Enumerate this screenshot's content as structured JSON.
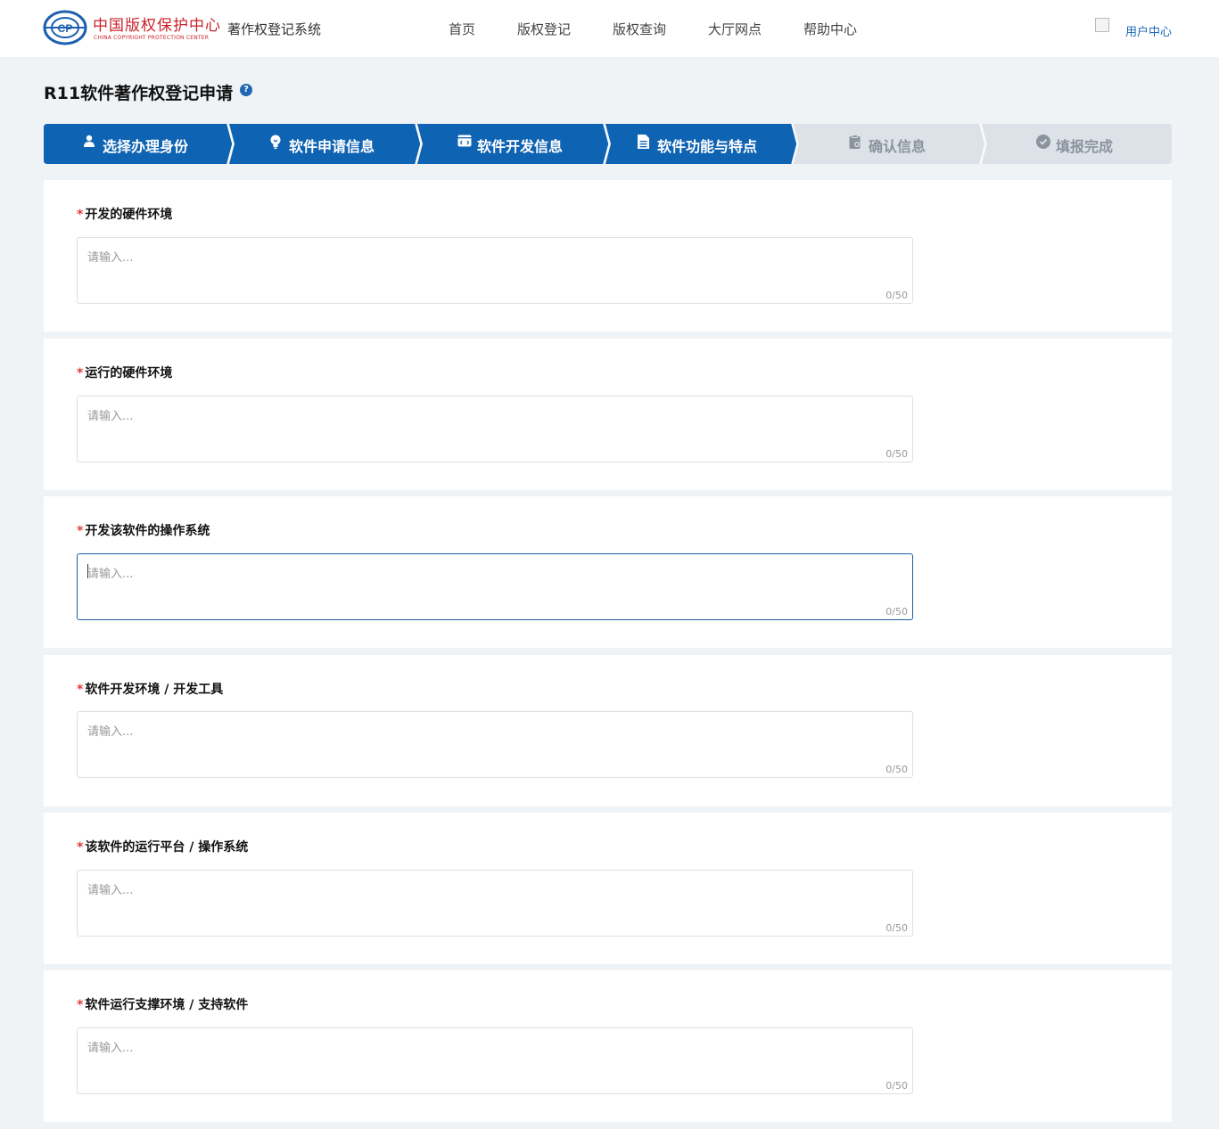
{
  "header": {
    "logo_cn": "中国版权保护中心",
    "logo_en": "CHINA COPYRIGHT PROTECTION CENTER",
    "logo_mark": "CP",
    "system_title": "著作权登记系统",
    "nav": [
      "首页",
      "版权登记",
      "版权查询",
      "大厅网点",
      "帮助中心"
    ],
    "user_center": "用户中心"
  },
  "page": {
    "title": "R11软件著作权登记申请",
    "help_symbol": "?"
  },
  "steps": [
    {
      "label": "选择办理身份",
      "icon": "user-icon",
      "glyph": "👤",
      "active": true
    },
    {
      "label": "软件申请信息",
      "icon": "lightbulb-icon",
      "glyph": "💡",
      "active": true
    },
    {
      "label": "软件开发信息",
      "icon": "code-window-icon",
      "glyph": "⌨",
      "active": true
    },
    {
      "label": "软件功能与特点",
      "icon": "document-icon",
      "glyph": "▤",
      "active": true
    },
    {
      "label": "确认信息",
      "icon": "clipboard-icon",
      "glyph": "▦",
      "active": false
    },
    {
      "label": "填报完成",
      "icon": "check-circle-icon",
      "glyph": "✔",
      "active": false
    }
  ],
  "colors": {
    "step_active": "#0f63b3",
    "step_inactive": "#dde2e8",
    "page_bg": "#f0f3f6",
    "required": "#e23b3b",
    "focus_border": "#1c5f9e"
  },
  "form": {
    "required_mark": "*",
    "placeholder": "请输入...",
    "fields": [
      {
        "label": "开发的硬件环境",
        "counter": "0/50",
        "focused": false
      },
      {
        "label": "运行的硬件环境",
        "counter": "0/50",
        "focused": false
      },
      {
        "label": "开发该软件的操作系统",
        "counter": "0/50",
        "focused": true
      },
      {
        "label": "软件开发环境 / 开发工具",
        "counter": "0/50",
        "focused": false
      },
      {
        "label": "该软件的运行平台 / 操作系统",
        "counter": "0/50",
        "focused": false
      },
      {
        "label": "软件运行支撑环境 / 支持软件",
        "counter": "0/50",
        "focused": false
      }
    ]
  }
}
